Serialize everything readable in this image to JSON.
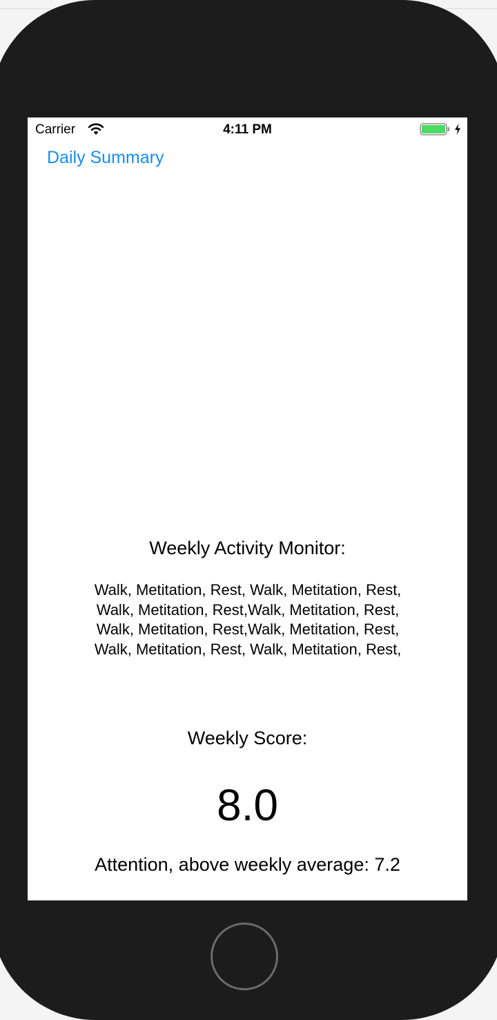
{
  "status_bar": {
    "carrier": "Carrier",
    "time": "4:11 PM",
    "battery_color": "#4cd964"
  },
  "nav": {
    "back_label": "Daily Summary",
    "accent_color": "#1a8cf0"
  },
  "activity": {
    "title": "Weekly Activity Monitor:",
    "list": "Walk, Metitation, Rest, Walk, Metitation, Rest, Walk, Metitation, Rest,Walk, Metitation, Rest, Walk, Metitation, Rest,Walk, Metitation, Rest, Walk, Metitation, Rest, Walk, Metitation, Rest,"
  },
  "score": {
    "label": "Weekly Score:",
    "value": "8.0",
    "attention": "Attention, above weekly average: 7.2"
  },
  "icons": {
    "wifi": "wifi-icon",
    "battery": "battery-icon",
    "charging": "charging-bolt-icon",
    "home": "home-button"
  }
}
